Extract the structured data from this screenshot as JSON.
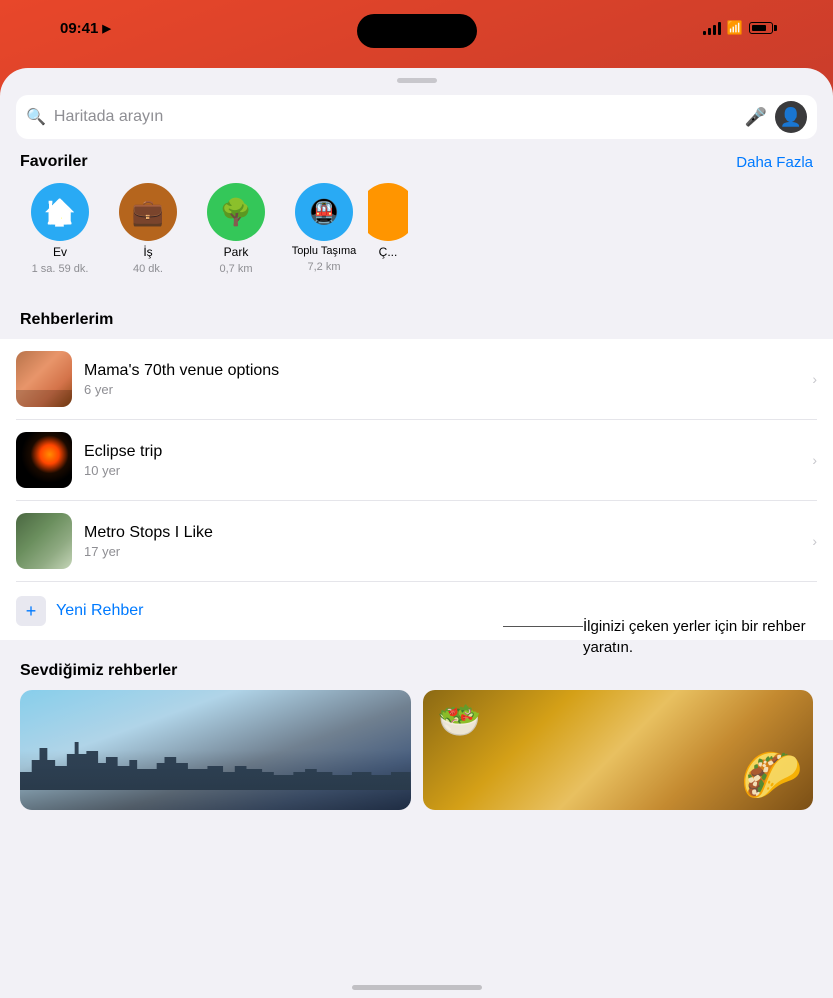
{
  "statusBar": {
    "time": "09:41",
    "hasLocation": true
  },
  "searchBar": {
    "placeholder": "Haritada arayın"
  },
  "favorites": {
    "sectionTitle": "Favoriler",
    "moreLabel": "Daha Fazla",
    "items": [
      {
        "id": "home",
        "label": "Ev",
        "sublabel": "1 sa. 59 dk.",
        "color": "#29aaf4",
        "icon": "🏠"
      },
      {
        "id": "work",
        "label": "İş",
        "sublabel": "40 dk.",
        "color": "#b5651d",
        "icon": "💼"
      },
      {
        "id": "park",
        "label": "Park",
        "sublabel": "0,7 km",
        "color": "#34c759",
        "icon": "🌳"
      },
      {
        "id": "transit",
        "label": "Toplu Taşıma",
        "sublabel": "7,2 km",
        "color": "#29aaf4",
        "icon": "🚇"
      },
      {
        "id": "extra",
        "label": "Ç...",
        "sublabel": "",
        "color": "#ff9500",
        "icon": ""
      }
    ]
  },
  "myGuides": {
    "sectionTitle": "Rehberlerim",
    "items": [
      {
        "id": "mama",
        "title": "Mama's 70th venue options",
        "count": "6 yer"
      },
      {
        "id": "eclipse",
        "title": "Eclipse trip",
        "count": "10 yer"
      },
      {
        "id": "metro",
        "title": "Metro Stops I Like",
        "count": "17 yer"
      }
    ],
    "newGuideLabel": "Yeni Rehber"
  },
  "annotation": {
    "text": "İlginizi çeken yerler için bir rehber yaratın."
  },
  "lovedGuides": {
    "sectionTitle": "Sevdiğimiz rehberler"
  }
}
